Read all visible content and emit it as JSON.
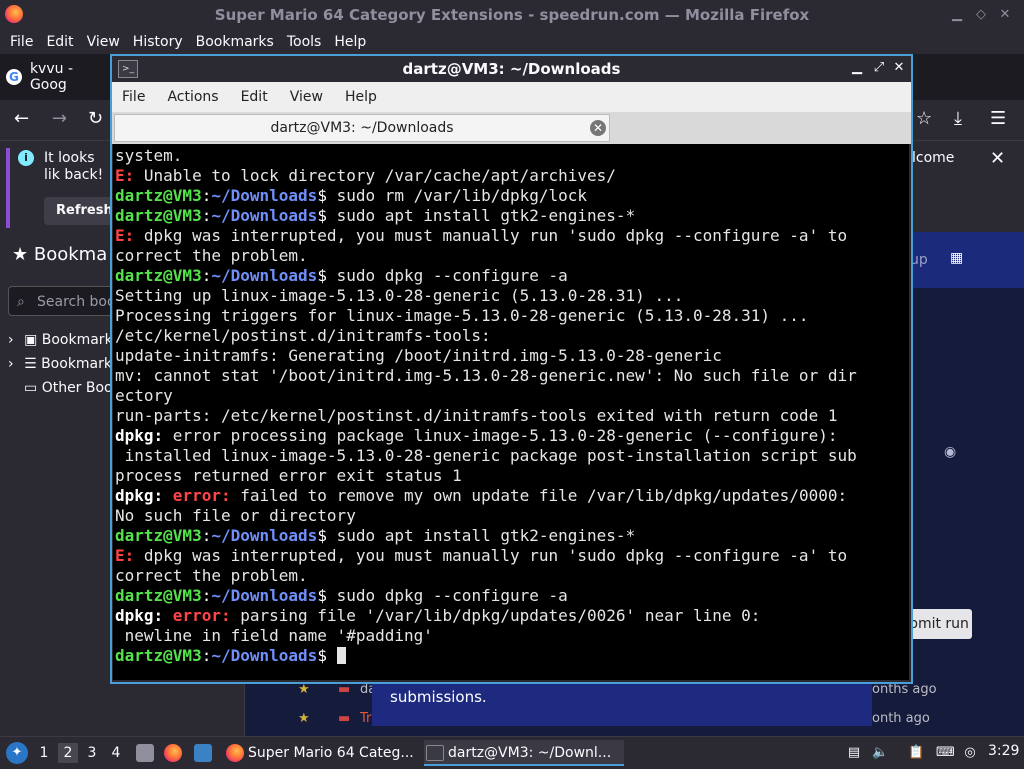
{
  "firefox": {
    "title": "Super Mario 64 Category Extensions - speedrun.com — Mozilla Firefox",
    "menu": [
      "File",
      "Edit",
      "View",
      "History",
      "Bookmarks",
      "Tools",
      "Help"
    ],
    "tab_label": "kvvu - Goog",
    "infobar": {
      "text": "It looks lik back!",
      "refresh_label": "Refresh",
      "welcome_fragment": "lcome"
    },
    "sidebar": {
      "header": "Bookma",
      "search_placeholder": "Search boo",
      "items": [
        "Bookmark",
        "Bookmark",
        "Other Boo"
      ]
    },
    "web": {
      "submit_label": "bmit run",
      "submissions_text": "submissions.",
      "rows": [
        {
          "user": "da",
          "time": "onths ago"
        },
        {
          "user": "Tr",
          "time": "onth ago"
        }
      ],
      "top_right": "up"
    }
  },
  "terminal": {
    "title": "dartz@VM3: ~/Downloads",
    "menu": [
      "File",
      "Actions",
      "Edit",
      "View",
      "Help"
    ],
    "tab_label": "dartz@VM3: ~/Downloads",
    "prompt_user": "dartz@VM3",
    "prompt_path": "~/Downloads",
    "lines": [
      {
        "t": "out",
        "text": "system."
      },
      {
        "t": "E",
        "text": "Unable to lock directory /var/cache/apt/archives/"
      },
      {
        "t": "cmd",
        "text": "sudo rm /var/lib/dpkg/lock"
      },
      {
        "t": "cmd",
        "text": "sudo apt install gtk2-engines-*"
      },
      {
        "t": "E",
        "text": "dpkg was interrupted, you must manually run 'sudo dpkg --configure -a' to"
      },
      {
        "t": "out",
        "text": "correct the problem."
      },
      {
        "t": "cmd",
        "text": "sudo dpkg --configure -a"
      },
      {
        "t": "out",
        "text": "Setting up linux-image-5.13.0-28-generic (5.13.0-28.31) ..."
      },
      {
        "t": "out",
        "text": "Processing triggers for linux-image-5.13.0-28-generic (5.13.0-28.31) ..."
      },
      {
        "t": "out",
        "text": "/etc/kernel/postinst.d/initramfs-tools:"
      },
      {
        "t": "out",
        "text": "update-initramfs: Generating /boot/initrd.img-5.13.0-28-generic"
      },
      {
        "t": "out",
        "text": "mv: cannot stat '/boot/initrd.img-5.13.0-28-generic.new': No such file or dir"
      },
      {
        "t": "out",
        "text": "ectory"
      },
      {
        "t": "out",
        "text": "run-parts: /etc/kernel/postinst.d/initramfs-tools exited with return code 1"
      },
      {
        "t": "dpkg",
        "text": "error processing package linux-image-5.13.0-28-generic (--configure):"
      },
      {
        "t": "out",
        "text": " installed linux-image-5.13.0-28-generic package post-installation script sub"
      },
      {
        "t": "out",
        "text": "process returned error exit status 1"
      },
      {
        "t": "dpkgerr",
        "text": "failed to remove my own update file /var/lib/dpkg/updates/0000:"
      },
      {
        "t": "out",
        "text": "No such file or directory"
      },
      {
        "t": "cmd",
        "text": "sudo apt install gtk2-engines-*"
      },
      {
        "t": "E",
        "text": "dpkg was interrupted, you must manually run 'sudo dpkg --configure -a' to"
      },
      {
        "t": "out",
        "text": "correct the problem."
      },
      {
        "t": "cmd",
        "text": "sudo dpkg --configure -a"
      },
      {
        "t": "dpkgerr",
        "text": "parsing file '/var/lib/dpkg/updates/0026' near line 0:"
      },
      {
        "t": "out",
        "text": " newline in field name '#padding'"
      },
      {
        "t": "prompt",
        "text": ""
      }
    ]
  },
  "taskbar": {
    "workspaces": [
      "1",
      "2",
      "3",
      "4"
    ],
    "active_workspace": "2",
    "tasks": [
      {
        "label": "Super Mario 64 Categ..."
      },
      {
        "label": "dartz@VM3: ~/Downl..."
      }
    ],
    "clock": "3:29"
  }
}
